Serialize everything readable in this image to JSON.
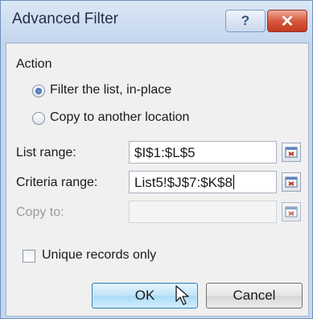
{
  "window": {
    "title": "Advanced Filter",
    "help_label": "?",
    "close_label": "✕"
  },
  "action": {
    "group_label": "Action",
    "options": [
      {
        "label": "Filter the list, in-place",
        "selected": true
      },
      {
        "label": "Copy to another location",
        "selected": false
      }
    ]
  },
  "fields": {
    "list_range": {
      "label": "List range:",
      "value": "$I$1:$L$5"
    },
    "criteria_range": {
      "label": "Criteria range:",
      "value": "List5!$J$7:$K$8"
    },
    "copy_to": {
      "label": "Copy to:",
      "value": ""
    }
  },
  "unique": {
    "label": "Unique records only",
    "checked": false
  },
  "buttons": {
    "ok": "OK",
    "cancel": "Cancel"
  },
  "icons": {
    "help": "help-icon",
    "close": "close-icon",
    "collapse": "collapse-dialog-icon",
    "cursor": "mouse-pointer-icon"
  },
  "colors": {
    "title_bar": "#c5d7ee",
    "close_button": "#d4543b",
    "ok_button": "#bfe3f8"
  }
}
